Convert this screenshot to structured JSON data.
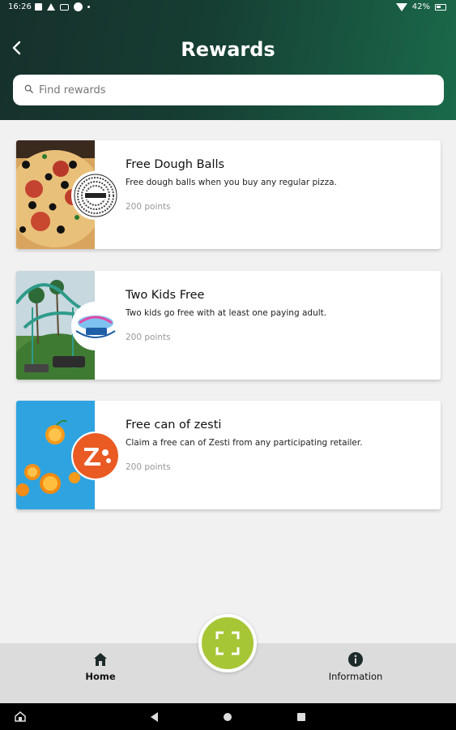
{
  "status_bar": {
    "time": "16:26",
    "battery": "42%"
  },
  "header": {
    "title": "Rewards",
    "back_icon": "back-arrow-icon"
  },
  "search": {
    "placeholder": "Find rewards",
    "value": ""
  },
  "rewards": [
    {
      "title": "Free Dough Balls",
      "description": "Free dough balls when you buy any regular pizza.",
      "points": "200 points",
      "image": "pizza-image",
      "logo": "pizzaexpress-logo"
    },
    {
      "title": "Two Kids Free",
      "description": "Two kids go free with at least one paying adult.",
      "points": "200 points",
      "image": "rollercoaster-image",
      "logo": "theme-park-logo"
    },
    {
      "title": "Free can of zesti",
      "description": "Claim a free can of Zesti from any participating retailer.",
      "points": "200 points",
      "image": "oranges-image",
      "logo": "zesti-logo"
    }
  ],
  "bottom_nav": {
    "home_label": "Home",
    "info_label": "Information",
    "scan_icon": "scan-icon"
  },
  "colors": {
    "header_dark": "#16302b",
    "header_light": "#1a6a4b",
    "scan_button": "#a6c636",
    "nav_background": "#dcdcdc"
  }
}
